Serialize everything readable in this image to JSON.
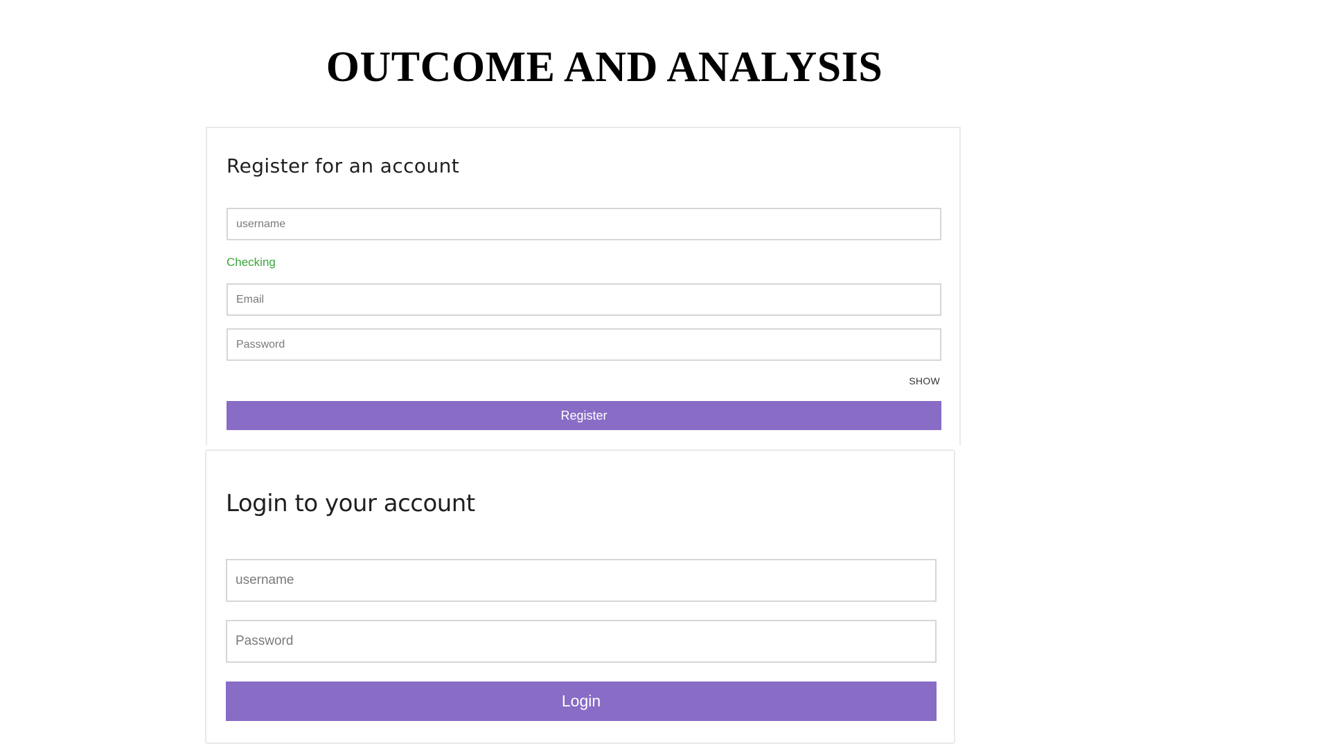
{
  "page": {
    "heading": "OUTCOME AND ANALYSIS"
  },
  "register": {
    "title": "Register for an account",
    "username_placeholder": "username",
    "username_value": "",
    "status_text": "Checking",
    "email_placeholder": "Email",
    "email_value": "",
    "password_placeholder": "Password",
    "password_value": "",
    "show_label": "SHOW",
    "button_label": "Register"
  },
  "login": {
    "title": "Login to your account",
    "username_placeholder": "username",
    "username_value": "",
    "password_placeholder": "Password",
    "password_value": "",
    "button_label": "Login"
  },
  "colors": {
    "accent": "#886cc6",
    "status_ok": "#3aa63a",
    "field_border": "#d6d6d6",
    "card_border": "#e9e9e9"
  }
}
